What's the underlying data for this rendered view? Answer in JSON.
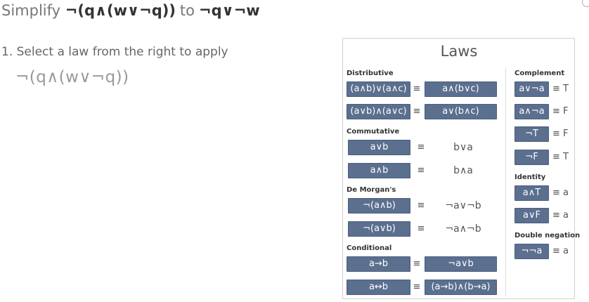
{
  "header": {
    "prefix": "Simplify",
    "expression": "¬(q∧(w∨¬q))",
    "connector": "to",
    "target": "¬q∨¬w"
  },
  "step": {
    "instruction": "1. Select a law from the right to apply",
    "current_expression": "¬(q∧(w∨¬q))"
  },
  "laws": {
    "title": "Laws",
    "equiv_symbol": "≡",
    "distributive": {
      "label": "Distributive",
      "rows": [
        {
          "lhs": "(a∧b)∨(a∧c)",
          "rhs": "a∧(b∨c)"
        },
        {
          "lhs": "(a∨b)∧(a∨c)",
          "rhs": "a∨(b∧c)"
        }
      ]
    },
    "commutative": {
      "label": "Commutative",
      "rows": [
        {
          "lhs": "a∨b",
          "rhs": "b∨a"
        },
        {
          "lhs": "a∧b",
          "rhs": "b∧a"
        }
      ]
    },
    "demorgans": {
      "label": "De Morgan's",
      "rows": [
        {
          "lhs": "¬(a∧b)",
          "rhs": "¬a∨¬b"
        },
        {
          "lhs": "¬(a∨b)",
          "rhs": "¬a∧¬b"
        }
      ]
    },
    "conditional": {
      "label": "Conditional",
      "rows": [
        {
          "lhs": "a→b",
          "rhs": "¬a∨b"
        },
        {
          "lhs": "a↔b",
          "rhs": "(a→b)∧(b→a)"
        }
      ]
    },
    "complement": {
      "label": "Complement",
      "rows": [
        {
          "lhs": "a∨¬a",
          "rhs": "T"
        },
        {
          "lhs": "a∧¬a",
          "rhs": "F"
        },
        {
          "lhs": "¬T",
          "rhs": "F"
        },
        {
          "lhs": "¬F",
          "rhs": "T"
        }
      ]
    },
    "identity": {
      "label": "Identity",
      "rows": [
        {
          "lhs": "a∧T",
          "rhs": "a"
        },
        {
          "lhs": "a∨F",
          "rhs": "a"
        }
      ]
    },
    "double_negation": {
      "label": "Double negation",
      "rows": [
        {
          "lhs": "¬¬a",
          "rhs": "a"
        }
      ]
    }
  },
  "colors": {
    "button_bg": "#5b6f8f",
    "button_text": "#ffffff",
    "panel_border": "#cfcfcf"
  }
}
